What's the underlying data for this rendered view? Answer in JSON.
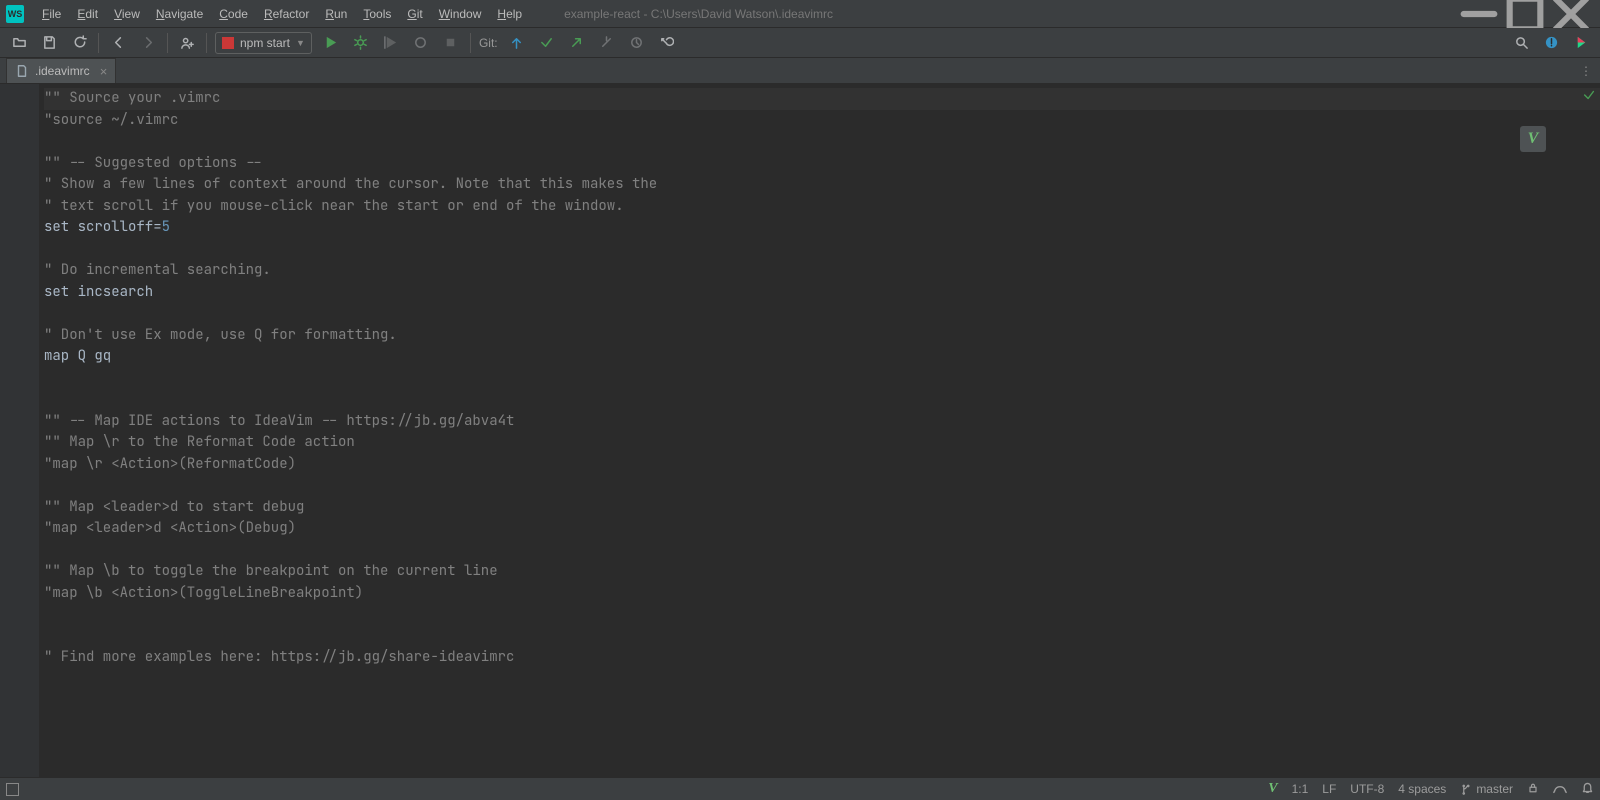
{
  "app": {
    "logo_text": "WS"
  },
  "title": "example-react - C:\\Users\\David Watson\\.ideavimrc",
  "menu": [
    "File",
    "Edit",
    "View",
    "Navigate",
    "Code",
    "Refactor",
    "Run",
    "Tools",
    "Git",
    "Window",
    "Help"
  ],
  "run_config": {
    "label": "npm start"
  },
  "git_label": "Git:",
  "tab": {
    "name": ".ideavimrc"
  },
  "editor_lines": [
    {
      "t": "cm",
      "text": "\"\" Source your .vimrc",
      "caret": true
    },
    {
      "t": "cm",
      "text": "\"source ~/.vimrc"
    },
    {
      "t": "blank",
      "text": ""
    },
    {
      "t": "cm",
      "text": "\"\" -- Suggested options --"
    },
    {
      "t": "cm",
      "text": "\" Show a few lines of context around the cursor. Note that this makes the"
    },
    {
      "t": "cm",
      "text": "\" text scroll if you mouse-click near the start or end of the window."
    },
    {
      "t": "set-num",
      "key": "set scrolloff",
      "op": "=",
      "val": "5"
    },
    {
      "t": "blank",
      "text": ""
    },
    {
      "t": "cm",
      "text": "\" Do incremental searching."
    },
    {
      "t": "plain",
      "text": "set incsearch"
    },
    {
      "t": "blank",
      "text": ""
    },
    {
      "t": "cm",
      "text": "\" Don't use Ex mode, use Q for formatting."
    },
    {
      "t": "plain",
      "text": "map Q gq"
    },
    {
      "t": "blank",
      "text": ""
    },
    {
      "t": "blank",
      "text": ""
    },
    {
      "t": "cm",
      "text": "\"\" -- Map IDE actions to IdeaVim -- https://jb.gg/abva4t"
    },
    {
      "t": "cm",
      "text": "\"\" Map \\r to the Reformat Code action"
    },
    {
      "t": "cm",
      "text": "\"map \\r <Action>(ReformatCode)"
    },
    {
      "t": "blank",
      "text": ""
    },
    {
      "t": "cm",
      "text": "\"\" Map <leader>d to start debug"
    },
    {
      "t": "cm",
      "text": "\"map <leader>d <Action>(Debug)"
    },
    {
      "t": "blank",
      "text": ""
    },
    {
      "t": "cm",
      "text": "\"\" Map \\b to toggle the breakpoint on the current line"
    },
    {
      "t": "cm",
      "text": "\"map \\b <Action>(ToggleLineBreakpoint)"
    },
    {
      "t": "blank",
      "text": ""
    },
    {
      "t": "blank",
      "text": ""
    },
    {
      "t": "cm",
      "text": "\" Find more examples here: https://jb.gg/share-ideavimrc"
    }
  ],
  "vim_badge": "V",
  "status": {
    "vim": "V",
    "pos": "1:1",
    "newline": "LF",
    "encoding": "UTF-8",
    "indent": "4 spaces",
    "branch": "master"
  }
}
